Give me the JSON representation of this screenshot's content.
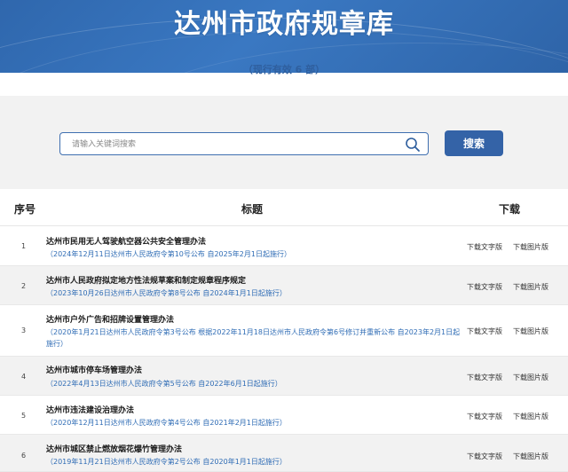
{
  "header": {
    "title": "达州市政府规章库",
    "subtitle": "（现行有效 6 部）"
  },
  "search": {
    "placeholder": "请输入关键词搜索",
    "button_label": "搜索"
  },
  "table": {
    "col_no": "序号",
    "col_title": "标题",
    "col_download": "下载",
    "download_text_label": "下载文字版",
    "download_image_label": "下载图片版",
    "rows": [
      {
        "no": "1",
        "title": "达州市民用无人驾驶航空器公共安全管理办法",
        "meta": "（2024年12月11日达州市人民政府令第10号公布  自2025年2月1日起施行）"
      },
      {
        "no": "2",
        "title": "达州市人民政府拟定地方性法规草案和制定规章程序规定",
        "meta": "（2023年10月26日达州市人民政府令第8号公布  自2024年1月1日起施行）"
      },
      {
        "no": "3",
        "title": "达州市户外广告和招牌设置管理办法",
        "meta": "（2020年1月21日达州市人民政府令第3号公布  根据2022年11月18日达州市人民政府令第6号修订并重新公布 自2023年2月1日起施行）"
      },
      {
        "no": "4",
        "title": "达州市城市停车场管理办法",
        "meta": "（2022年4月13日达州市人民政府令第5号公布  自2022年6月1日起施行）"
      },
      {
        "no": "5",
        "title": "达州市违法建设治理办法",
        "meta": "（2020年12月11日达州市人民政府令第4号公布  自2021年2月1日起施行）"
      },
      {
        "no": "6",
        "title": "达州市城区禁止燃放烟花爆竹管理办法",
        "meta": "（2019年11月21日达州市人民政府令第2号公布  自2020年1月1日起施行）"
      }
    ]
  }
}
